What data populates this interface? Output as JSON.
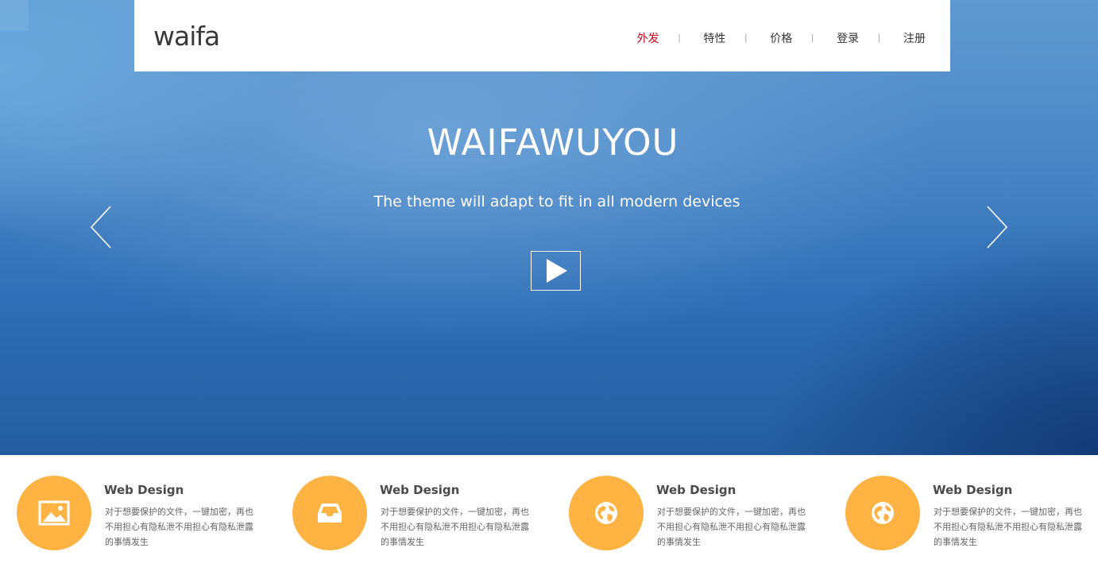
{
  "header": {
    "logo": "waifa",
    "nav": [
      {
        "label": "外发",
        "active": true
      },
      {
        "label": "特性",
        "active": false
      },
      {
        "label": "价格",
        "active": false
      },
      {
        "label": "登录",
        "active": false
      },
      {
        "label": "注册",
        "active": false
      }
    ],
    "separator": "|"
  },
  "hero": {
    "title": "WAIFAWUYOU",
    "subtitle": "The theme will adapt to fit in all modern devices",
    "play_icon": "play-icon",
    "prev_icon": "chevron-left-icon",
    "next_icon": "chevron-right-icon"
  },
  "features": [
    {
      "icon": "image-icon",
      "title": "Web Design",
      "desc": "对于想要保护的文件，一键加密，再也不用担心有隐私泄不用担心有隐私泄露的事情发生"
    },
    {
      "icon": "inbox-icon",
      "title": "Web Design",
      "desc": "对于想要保护的文件，一键加密，再也不用担心有隐私泄不用担心有隐私泄露的事情发生"
    },
    {
      "icon": "globe-icon",
      "title": "Web Design",
      "desc": "对于想要保护的文件，一键加密，再也不用担心有隐私泄不用担心有隐私泄露的事情发生"
    },
    {
      "icon": "globe-icon",
      "title": "Web Design",
      "desc": "对于想要保护的文件，一键加密，再也不用担心有隐私泄不用担心有隐私泄露的事情发生"
    }
  ],
  "colors": {
    "accent": "#ffb343",
    "active_nav": "#d0021b",
    "hero_blue": "#2f6fb7"
  }
}
